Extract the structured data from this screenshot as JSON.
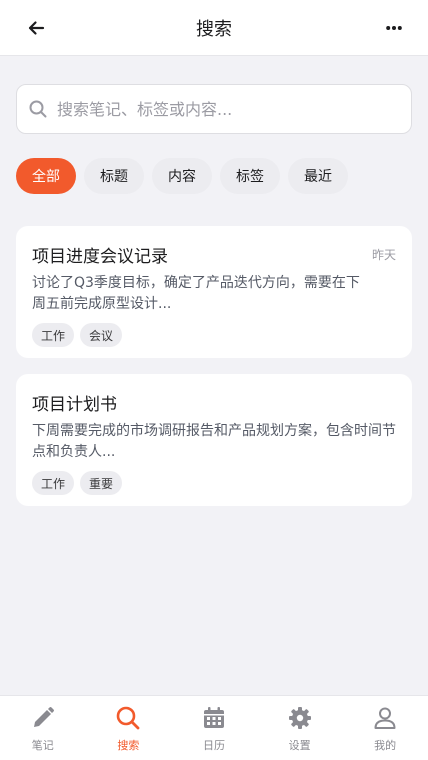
{
  "header": {
    "title": "搜索"
  },
  "search": {
    "placeholder": "搜索笔记、标签或内容...",
    "value": ""
  },
  "filters": [
    {
      "label": "全部",
      "active": true
    },
    {
      "label": "标题",
      "active": false
    },
    {
      "label": "内容",
      "active": false
    },
    {
      "label": "标签",
      "active": false
    },
    {
      "label": "最近",
      "active": false
    }
  ],
  "results": [
    {
      "title": "项目进度会议记录",
      "date": "昨天",
      "snippet_line1": "讨论了Q3季度目标，确定了产品迭代方向，需要在下",
      "snippet_line2": "周五前完成原型设计...",
      "tags": [
        "工作",
        "会议"
      ]
    },
    {
      "title": "项目计划书",
      "date": "",
      "snippet_line1": "下周需要完成的市场调研报告和产品规划方案，包含时间节",
      "snippet_line2": "点和负责人...",
      "tags": [
        "工作",
        "重要"
      ]
    }
  ],
  "tabbar": [
    {
      "label": "笔记",
      "icon": "pencil-icon",
      "active": false
    },
    {
      "label": "搜索",
      "icon": "search-icon",
      "active": true
    },
    {
      "label": "日历",
      "icon": "calendar-icon",
      "active": false
    },
    {
      "label": "设置",
      "icon": "gear-icon",
      "active": false
    },
    {
      "label": "我的",
      "icon": "user-icon",
      "active": false
    }
  ],
  "colors": {
    "accent": "#f25a2c",
    "background": "#f2f2f6",
    "chip": "#ececf0"
  }
}
